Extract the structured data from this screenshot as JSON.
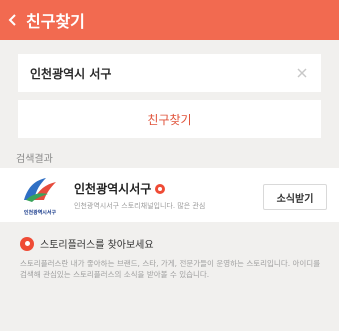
{
  "header": {
    "back_icon": "chevron-left-icon",
    "title": "친구찾기"
  },
  "search": {
    "query": "인천광역시 서구",
    "clear_icon": "close-icon"
  },
  "find_button_label": "친구찾기",
  "results": {
    "section_label": "검색결과",
    "items": [
      {
        "name": "인천광역시서구",
        "description": "인천광역시서구 스토리채널입니다. 많은 관심",
        "logo_caption": "인천광역시서구",
        "subscribe_label": "소식받기"
      }
    ]
  },
  "info": {
    "title": "스토리플러스를 찾아보세요",
    "body": "스토리플러스란 내가 좋아하는 브랜드, 스타, 가게, 전문가들이 운영하는 스토리입니다. 아이디를 검색해 관심있는 스토리플러스의 소식을 받아볼 수 있습니다."
  },
  "colors": {
    "accent": "#f26a50",
    "accent_text": "#e0533a",
    "background": "#f1f0ee"
  }
}
